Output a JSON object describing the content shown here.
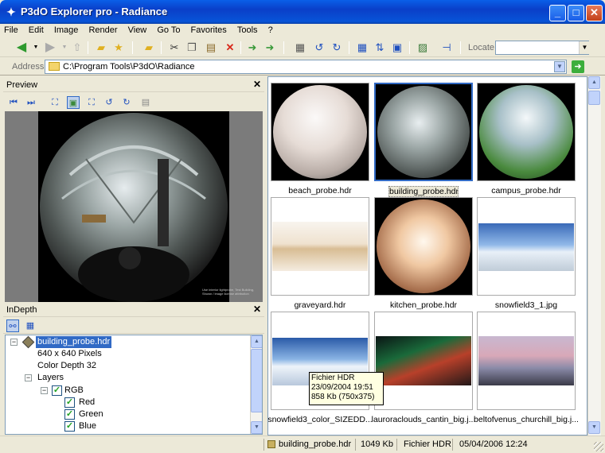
{
  "window": {
    "title": "P3dO Explorer pro - Radiance",
    "minimize": "_",
    "maximize": "□",
    "close": "✕"
  },
  "menu": [
    "File",
    "Edit",
    "Image",
    "Render",
    "View",
    "Go To",
    "Favorites",
    "Tools",
    "?"
  ],
  "toolbar": {
    "locate_label": "Locate",
    "locate_value": ""
  },
  "address": {
    "label": "Address",
    "path": "C:\\Program Tools\\P3dO\\Radiance"
  },
  "preview": {
    "title": "Preview",
    "close": "✕",
    "caption": "Use interior lightprobe, Test Building, Shown / image license attribution"
  },
  "indepth": {
    "title": "InDepth",
    "close": "✕",
    "tree": [
      {
        "label": "building_probe.hdr",
        "level": 0,
        "expander": "−",
        "selected": true
      },
      {
        "label": "640 x 640 Pixels",
        "level": 1
      },
      {
        "label": "Color Depth 32",
        "level": 1
      },
      {
        "label": "Layers",
        "level": 1,
        "expander": "−"
      },
      {
        "label": "RGB",
        "level": 2,
        "expander": "−",
        "checked": true
      },
      {
        "label": "Red",
        "level": 3,
        "checked": true
      },
      {
        "label": "Green",
        "level": 3,
        "checked": true
      },
      {
        "label": "Blue",
        "level": 3,
        "checked": true
      }
    ]
  },
  "thumbnails": [
    {
      "name": "beach_probe.hdr",
      "kind": "probe",
      "palette": [
        "#f4f1f0",
        "#d9cdc6",
        "#8f8a8a",
        "#3c3a3a"
      ]
    },
    {
      "name": "building_probe.hdr",
      "kind": "probe",
      "selected": true,
      "palette": [
        "#e8eef0",
        "#8c9896",
        "#4e5552",
        "#1e1e1e"
      ]
    },
    {
      "name": "campus_probe.hdr",
      "kind": "probe",
      "palette": [
        "#eef4f8",
        "#7ea08e",
        "#3f7a36",
        "#1f3a1c"
      ]
    },
    {
      "name": "graveyard.hdr",
      "kind": "pano",
      "palette": [
        "#f6f1ea",
        "#e4cfae",
        "#d8b98c",
        "#f6efe4"
      ]
    },
    {
      "name": "kitchen_probe.hdr",
      "kind": "probe",
      "palette": [
        "#fff4e8",
        "#e6b58c",
        "#a1684a",
        "#3a2418"
      ]
    },
    {
      "name": "snowfield3_1.jpg",
      "kind": "pano",
      "palette": [
        "#4a7ac0",
        "#a8c8ec",
        "#e8f0f8",
        "#c8d4e0"
      ]
    },
    {
      "name": "snowfield3_color_SIZEDD...",
      "kind": "pano",
      "palette": [
        "#2a5aa8",
        "#8ab4e4",
        "#e8f0fa",
        "#b8c8dc"
      ]
    },
    {
      "name": "lauroraclouds_cantin_big.j...",
      "kind": "pano",
      "palette": [
        "#0a1414",
        "#1a6a3a",
        "#b8402a",
        "#222"
      ]
    },
    {
      "name": "beltofvenus_churchill_big.j...",
      "kind": "pano",
      "palette": [
        "#c8b8d0",
        "#d8a8b8",
        "#8a8aa8",
        "#3a3a48"
      ]
    }
  ],
  "tooltip": {
    "line1": "Fichier HDR",
    "line2": "23/09/2004 19:51",
    "line3": "858 Kb  (750x375)"
  },
  "status": {
    "file": "building_probe.hdr",
    "size": "1049 Kb",
    "type": "Fichier HDR",
    "date": "05/04/2006 12:24"
  }
}
